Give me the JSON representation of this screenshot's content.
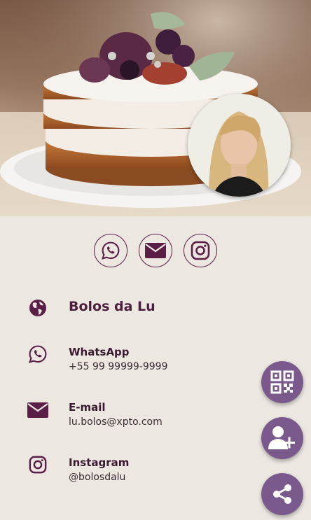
{
  "business": {
    "name": "Bolos da Lu"
  },
  "social": [
    {
      "name": "whatsapp",
      "icon": "whatsapp-icon"
    },
    {
      "name": "email",
      "icon": "envelope-icon"
    },
    {
      "name": "instagram",
      "icon": "instagram-icon"
    }
  ],
  "contacts": {
    "whatsapp": {
      "label": "WhatsApp",
      "value": "+55 99 99999-9999",
      "icon": "whatsapp-icon"
    },
    "email": {
      "label": "E-mail",
      "value": "lu.bolos@xpto.com",
      "icon": "envelope-icon"
    },
    "instagram": {
      "label": "Instagram",
      "value": "@bolosdalu",
      "icon": "instagram-icon"
    }
  },
  "fabs": [
    {
      "name": "qr-code",
      "icon": "qr-code-icon"
    },
    {
      "name": "add-contact",
      "icon": "add-user-icon"
    },
    {
      "name": "share",
      "icon": "share-icon"
    }
  ],
  "colors": {
    "primary": "#5b1f47",
    "fab": "#7a5a8c",
    "background": "#ece7e1"
  }
}
